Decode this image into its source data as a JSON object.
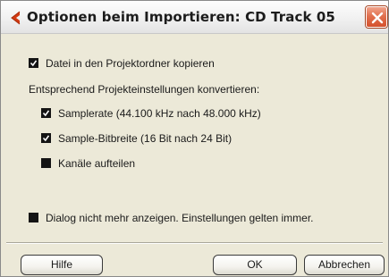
{
  "dialog": {
    "title": "Optionen beim Importieren: CD Track 05",
    "icon": "left-arrow-icon",
    "close_icon": "close-x-icon"
  },
  "options": {
    "copy_to_project": {
      "label": "Datei in den Projektordner kopieren",
      "checked": true
    },
    "convert_heading": "Entsprechend Projekteinstellungen konvertieren:",
    "samplerate": {
      "label": "Samplerate (44.100 kHz nach 48.000 kHz)",
      "checked": true
    },
    "bitdepth": {
      "label": "Sample-Bitbreite (16 Bit nach 24 Bit)",
      "checked": true
    },
    "split_channels": {
      "label": "Kanäle aufteilen",
      "checked": false
    },
    "dont_show": {
      "label": "Dialog nicht mehr anzeigen. Einstellungen gelten immer.",
      "checked": false
    }
  },
  "buttons": {
    "help": "Hilfe",
    "ok": "OK",
    "cancel": "Abbrechen"
  },
  "colors": {
    "arrow": "#d23a12",
    "close": "#e2714f",
    "dialog_bg": "#ece9d8"
  }
}
